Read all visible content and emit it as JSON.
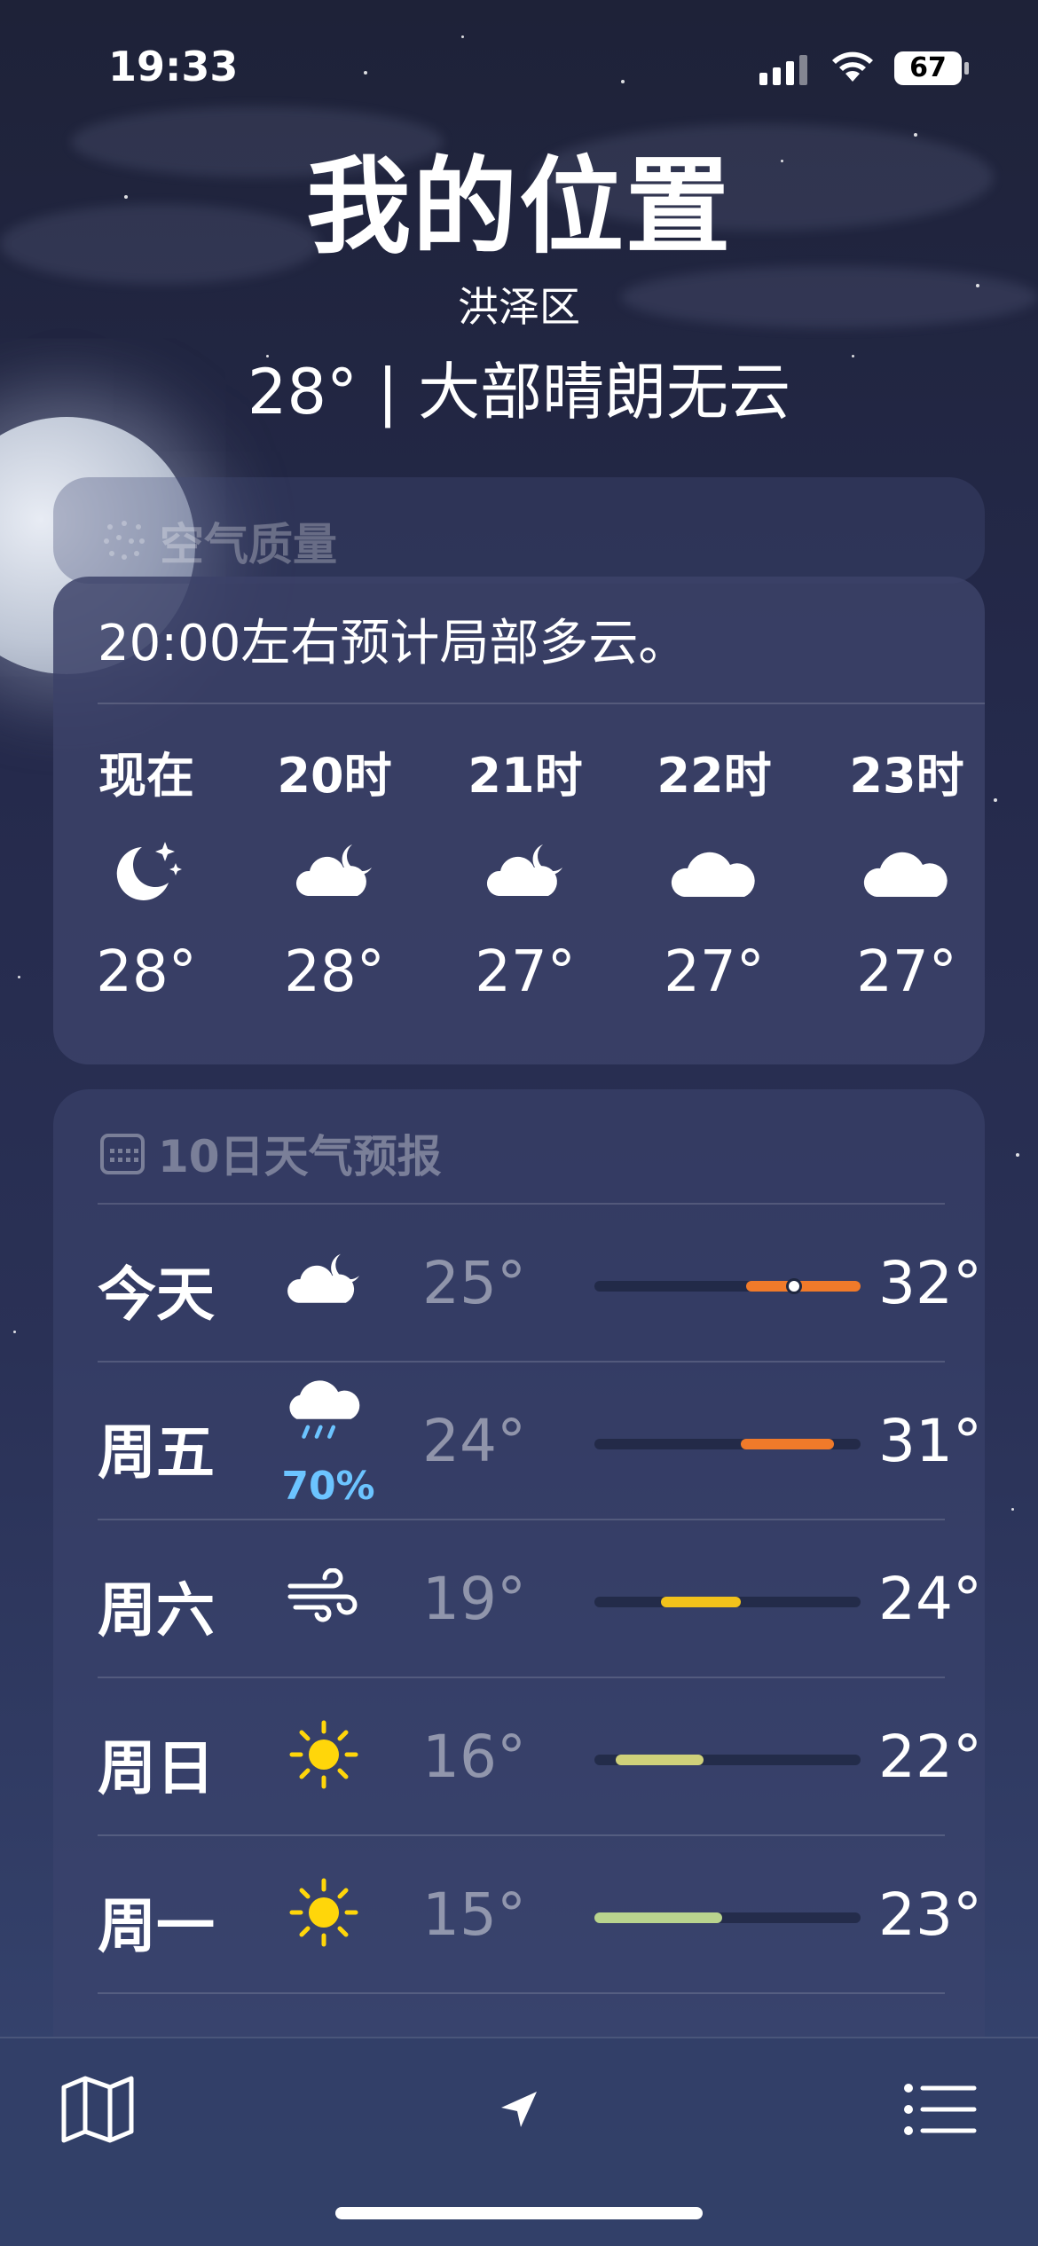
{
  "status_bar": {
    "time": "19:33",
    "battery": "67"
  },
  "header": {
    "title": "我的位置",
    "district": "洪泽区",
    "condition": "28° | 大部晴朗无云"
  },
  "air_quality": {
    "label": "空气质量"
  },
  "hourly": {
    "summary": "20:00左右预计局部多云。",
    "hours": [
      {
        "label": "现在",
        "icon": "moon-stars-icon",
        "temp": "28°"
      },
      {
        "label": "20时",
        "icon": "cloud-moon-icon",
        "temp": "28°"
      },
      {
        "label": "21时",
        "icon": "cloud-moon-icon",
        "temp": "27°"
      },
      {
        "label": "22时",
        "icon": "cloud-icon",
        "temp": "27°"
      },
      {
        "label": "23时",
        "icon": "cloud-icon",
        "temp": "27°"
      }
    ]
  },
  "daily": {
    "title": "10日天气预报",
    "days": [
      {
        "day": "今天",
        "icon": "cloud-moon-icon",
        "low": "25°",
        "high": "32°",
        "precip": "",
        "range_start": 0.57,
        "range_end": 1.0,
        "current": 0.75,
        "color": "#f07a2a"
      },
      {
        "day": "周五",
        "icon": "cloud-rain-icon",
        "low": "24°",
        "high": "31°",
        "precip": "70%",
        "range_start": 0.55,
        "range_end": 0.9,
        "current": null,
        "color": "#f07a2a"
      },
      {
        "day": "周六",
        "icon": "wind-icon",
        "low": "19°",
        "high": "24°",
        "precip": "",
        "range_start": 0.25,
        "range_end": 0.55,
        "current": null,
        "color": "#f2c21b"
      },
      {
        "day": "周日",
        "icon": "sun-icon",
        "low": "16°",
        "high": "22°",
        "precip": "",
        "range_start": 0.08,
        "range_end": 0.41,
        "current": null,
        "color": "#cfd17a"
      },
      {
        "day": "周一",
        "icon": "sun-icon",
        "low": "15°",
        "high": "23°",
        "precip": "",
        "range_start": 0.0,
        "range_end": 0.48,
        "current": null,
        "color": "#b9d48e"
      }
    ]
  },
  "colors": {
    "sun": "#ffd60a",
    "precip": "#6cc4ff"
  }
}
